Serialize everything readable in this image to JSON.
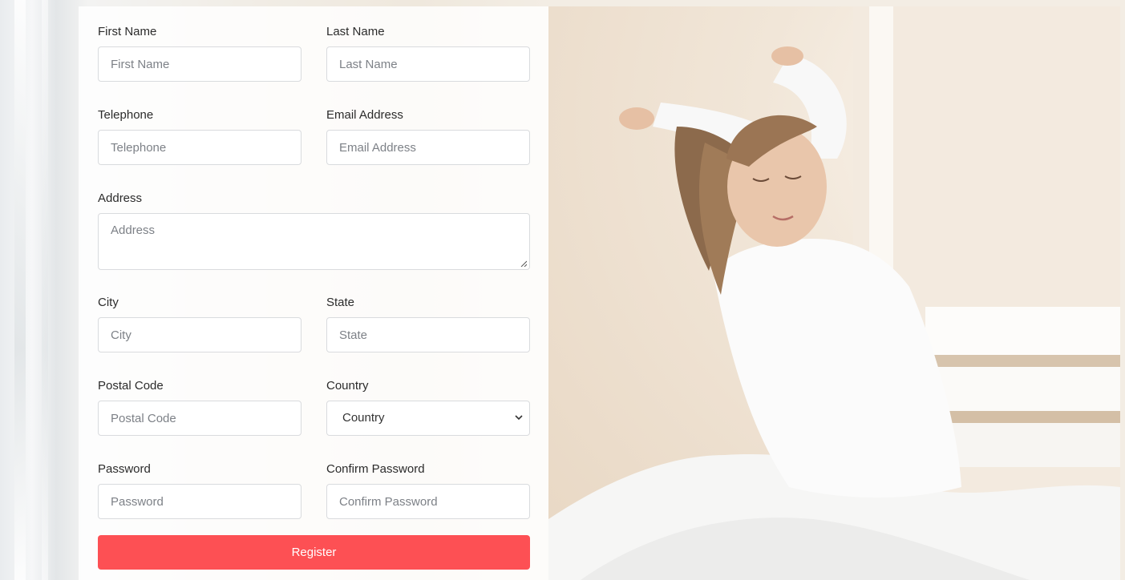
{
  "form": {
    "first_name": {
      "label": "First Name",
      "placeholder": "First Name"
    },
    "last_name": {
      "label": "Last Name",
      "placeholder": "Last Name"
    },
    "telephone": {
      "label": "Telephone",
      "placeholder": "Telephone"
    },
    "email": {
      "label": "Email Address",
      "placeholder": "Email Address"
    },
    "address": {
      "label": "Address",
      "placeholder": "Address"
    },
    "city": {
      "label": "City",
      "placeholder": "City"
    },
    "state": {
      "label": "State",
      "placeholder": "State"
    },
    "postal_code": {
      "label": "Postal Code",
      "placeholder": "Postal Code"
    },
    "country": {
      "label": "Country",
      "selected": "Country"
    },
    "password": {
      "label": "Password",
      "placeholder": "Password"
    },
    "confirm_password": {
      "label": "Confirm Password",
      "placeholder": "Confirm Password"
    },
    "register_label": "Register"
  },
  "colors": {
    "accent": "#fd5054",
    "input_border": "#d9dbde",
    "label_text": "#2b2b2b",
    "placeholder_text": "#7d8187"
  },
  "icons": {
    "country_select": "chevron-down-icon",
    "address_textarea": "resize-grip-icon"
  }
}
